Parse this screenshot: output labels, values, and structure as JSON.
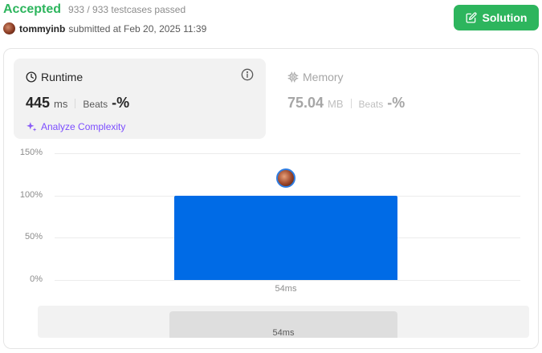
{
  "header": {
    "status": "Accepted",
    "testcases": "933 / 933 testcases passed",
    "username": "tommyinb",
    "submitted": "submitted at Feb 20, 2025 11:39",
    "solution_button": "Solution",
    "colors": {
      "accepted": "#2db55d",
      "button_bg": "#2db55d"
    }
  },
  "runtime": {
    "title": "Runtime",
    "value": "445",
    "unit": "ms",
    "beats_label": "Beats",
    "beats_value": "-%",
    "analyze_link": "Analyze Complexity",
    "icons": [
      "clock-icon",
      "info-icon",
      "sparkle-icon"
    ]
  },
  "memory": {
    "title": "Memory",
    "value": "75.04",
    "unit": "MB",
    "beats_label": "Beats",
    "beats_value": "-%",
    "icons": [
      "chip-icon"
    ]
  },
  "chart_data": {
    "type": "bar",
    "categories": [
      "54ms"
    ],
    "values": [
      100
    ],
    "y_ticks": [
      "150%",
      "100%",
      "50%",
      "0%"
    ],
    "ylim": [
      0,
      150
    ],
    "grid": true,
    "bar_color": "#006be6"
  },
  "scroller": {
    "label": "54ms"
  }
}
